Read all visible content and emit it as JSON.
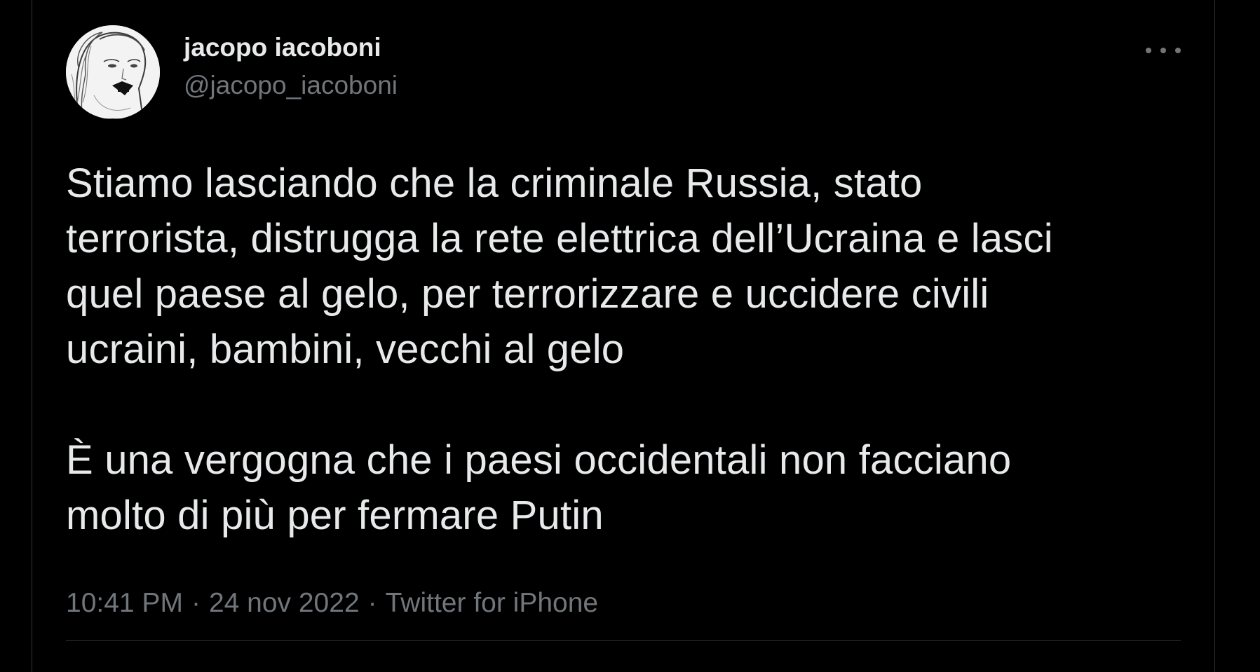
{
  "tweet": {
    "author": {
      "display_name": "jacopo iacoboni",
      "handle": "@jacopo_iacoboni",
      "avatar_icon": "sketch-portrait-avatar"
    },
    "more_icon": "more-horizontal-icon",
    "text_lines_p1": [
      "Stiamo lasciando che la criminale Russia, stato",
      "terrorista, distrugga la rete elettrica dell’Ucraina e lasci",
      "quel paese al gelo, per terrorizzare e uccidere civili",
      "ucraini, bambini, vecchi al gelo"
    ],
    "text_lines_p2": [
      "È una vergogna che i paesi occidentali non facciano",
      "molto di più per fermare Putin"
    ],
    "time": "10:41 PM",
    "date": "24 nov 2022",
    "source": "Twitter for iPhone",
    "separator": "·"
  },
  "colors": {
    "background": "#000000",
    "text_primary": "#e7e9ea",
    "text_secondary": "#71767b",
    "border": "#2f3336"
  }
}
